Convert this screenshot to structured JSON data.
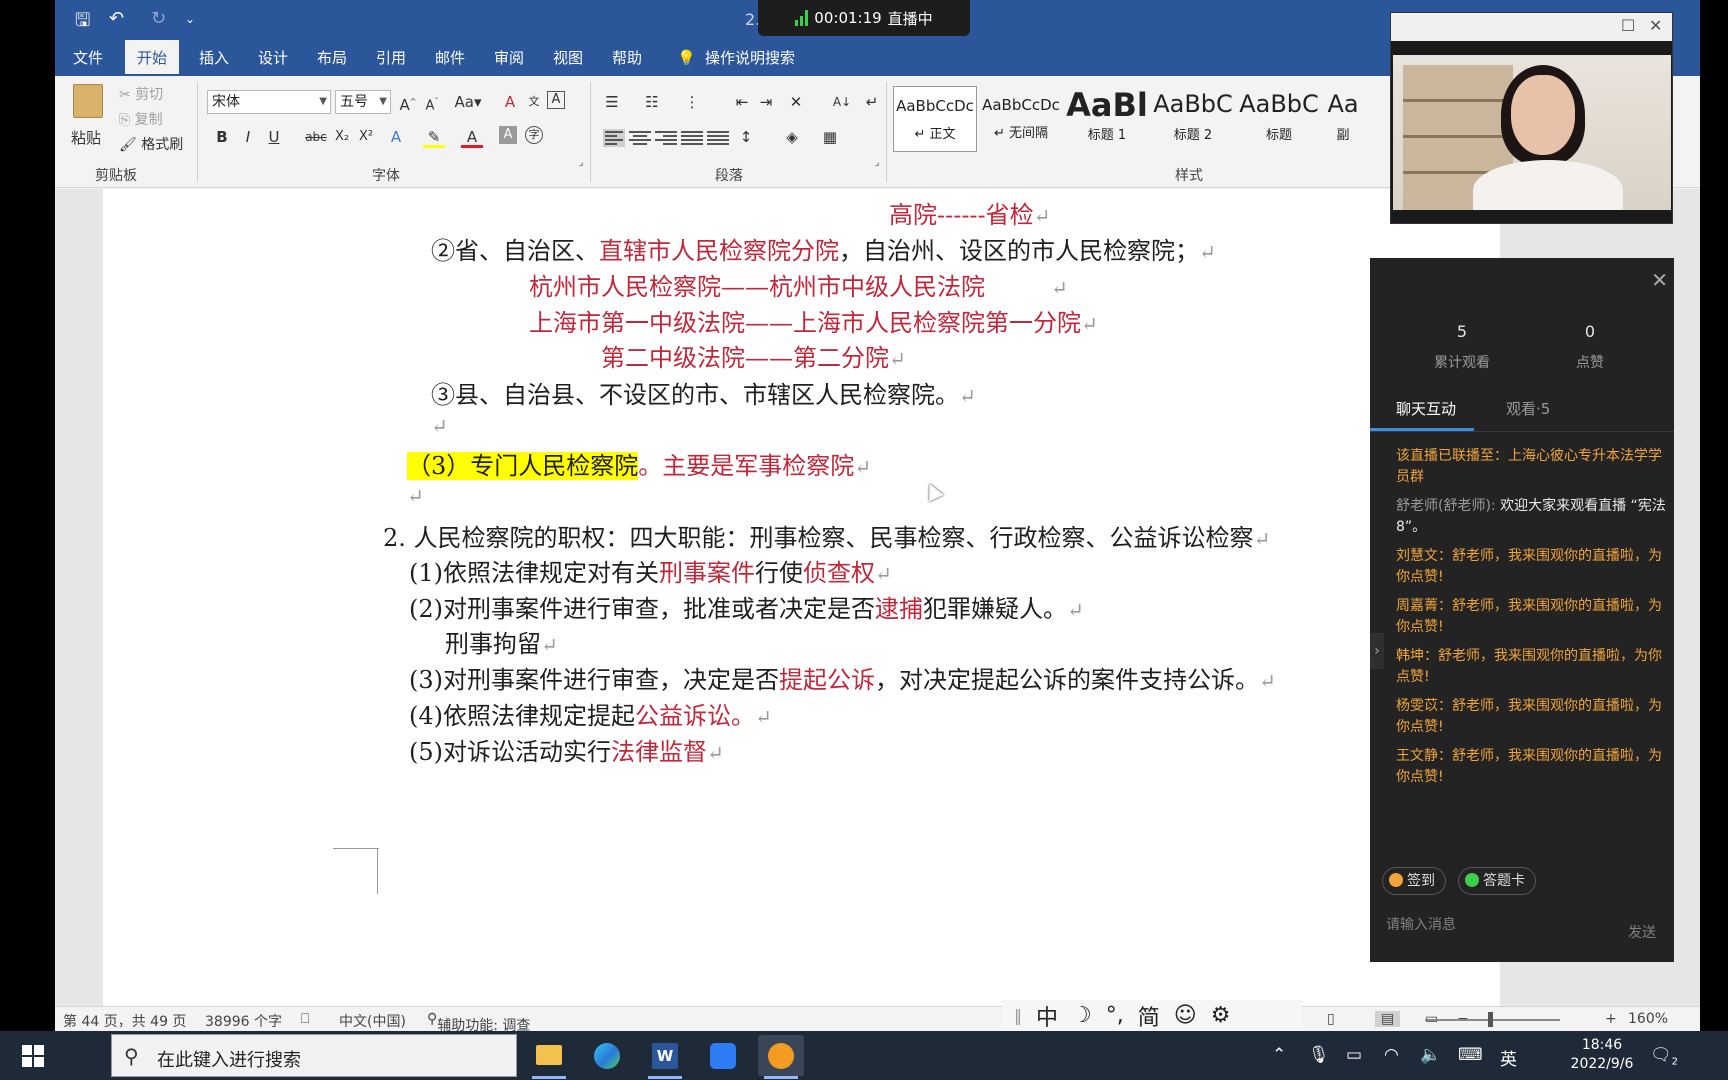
{
  "title_bar": {
    "document_title": "2⁠…⁠rd",
    "live": {
      "timer": "00:01:19",
      "status": "直播中"
    }
  },
  "tabs": [
    "文件",
    "开始",
    "插入",
    "设计",
    "布局",
    "引用",
    "邮件",
    "审阅",
    "视图",
    "帮助",
    "操作说明搜索"
  ],
  "ribbon": {
    "clipboard": {
      "paste": "粘贴",
      "cut": "剪切",
      "copy": "复制",
      "format_painter": "格式刷",
      "label": "剪贴板"
    },
    "font": {
      "name": "宋体",
      "size": "五号",
      "label": "字体"
    },
    "paragraph": {
      "label": "段落"
    },
    "styles": {
      "label": "样式",
      "items": [
        {
          "preview": "AaBbCcDc",
          "name": "↵ 正文"
        },
        {
          "preview": "AaBbCcDc",
          "name": "↵ 无间隔"
        },
        {
          "preview": "AaBl",
          "name": "标题 1"
        },
        {
          "preview": "AaBbC",
          "name": "标题 2"
        },
        {
          "preview": "AaBbC",
          "name": "标题"
        },
        {
          "preview": "Aa",
          "name": "副"
        }
      ]
    }
  },
  "document": {
    "l1": "高院------省检",
    "l2a": "②省、自治区、",
    "l2b": "直辖市人民检察院分院",
    "l2c": "，自治州、设区的市人民检察院；",
    "l3": "杭州市人民检察院——杭州市中级人民法院",
    "l4": "上海市第一中级法院——上海市人民检察院第一分院",
    "l5": "第二中级法院——第二分院",
    "l6": "③县、自治县、不设区的市、市辖区人民检察院。",
    "l7a": "（3）专门人民检察院",
    "l7b": "。",
    "l7c": "主要是军事检察院",
    "l8": "2. 人民检察院的职权：四大职能：刑事检察、民事检察、行政检察、公益诉讼检察",
    "l9a": "(1)依照法律规定对有关",
    "l9b": "刑事案件",
    "l9c": "行使",
    "l9d": "侦查权",
    "l10a": "(2)对刑事案件进行审查，批准或者决定是否",
    "l10b": "逮捕",
    "l10c": "犯罪嫌疑人。",
    "l11": "刑事拘留",
    "l12a": "(3)对刑事案件进行审查，决定是否",
    "l12b": "提起公诉",
    "l12c": "，对决定提起公诉的案件支持公诉。",
    "l13a": "(4)依照法律规定提起",
    "l13b": "公益诉讼。",
    "l14a": "(5)对诉讼活动实行",
    "l14b": "法律监督",
    "para_mark": "↵"
  },
  "status_bar": {
    "page": "第 44 页，共 49 页",
    "words": "38996 个字",
    "language": "中文(中国)",
    "accessibility": "辅助功能: 调查",
    "zoom": "160%",
    "zoom_level": 160
  },
  "ime": [
    "中",
    "☽",
    "°,",
    "简",
    "☺",
    "⚙"
  ],
  "live_panel": {
    "stats": [
      {
        "value": "5",
        "label": "累计观看"
      },
      {
        "value": "0",
        "label": "点赞"
      }
    ],
    "tabs": [
      "聊天互动",
      "观看·5"
    ],
    "messages": [
      {
        "who": "",
        "text": "该直播已联播至：上海心彼心专升本法学学员群"
      },
      {
        "who": "舒老师(舒老师):",
        "text": " 欢迎大家来观看直播 “宪法8”。"
      },
      {
        "who": "",
        "text": "刘慧文：舒老师，我来围观你的直播啦，为你点赞!"
      },
      {
        "who": "",
        "text": "周嘉菁：舒老师，我来围观你的直播啦，为你点赞!"
      },
      {
        "who": "",
        "text": "韩坤：舒老师，我来围观你的直播啦，为你点赞!"
      },
      {
        "who": "",
        "text": "杨雯苡：舒老师，我来围观你的直播啦，为你点赞!"
      },
      {
        "who": "",
        "text": "王文静：舒老师，我来围观你的直播啦，为你点赞!"
      }
    ],
    "buttons": {
      "sign_in": "签到",
      "answer_card": "答题卡"
    },
    "input_placeholder": "请输入消息",
    "send": "发送"
  },
  "taskbar": {
    "search_placeholder": "在此键入进行搜索",
    "tray_lang": "英",
    "time": "18:46",
    "date": "2022/9/6",
    "notifications": "2"
  },
  "colors": {
    "word_blue": "#2b579a",
    "doc_red": "#c0283b",
    "highlight": "#ffff00",
    "chat_orange": "#f0a43b"
  }
}
